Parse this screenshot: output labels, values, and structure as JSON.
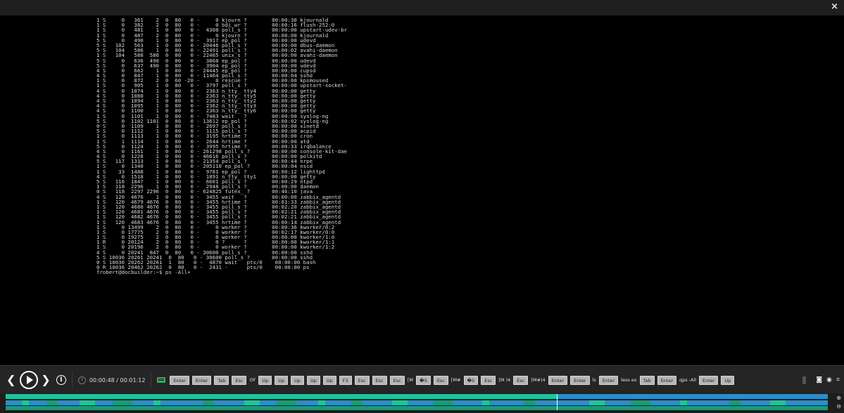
{
  "window": {
    "close_glyph": "×"
  },
  "terminal": {
    "lines": [
      "1 S     0   361    2  0  80   0 -     0 kjourn ?        00:00:30 kjournald",
      "1 S     0   382    2  0  80   0 -     0 bdi_wr ?        00:00:16 flush-252:0",
      "1 S     0   481    1  0  80   0 -  4308 poll_s ?        00:00:00 upstart-udev-br",
      "1 S     0   487    2  0  80   0 -     0 kjourn ?        00:00:00 kjournald",
      "5 S     0   490    1  0  80   0 -  3917 ep_pol ?        00:00:00 udevd",
      "5 S   102   563    1  0  80   0 - 20446 poll_s ?        00:00:00 dbus-daemon",
      "5 S   104   586    1  0  80   0 - 22491 poll_s ?        00:00:02 avahi-daemon",
      "1 S   104   588  586  0  80   0 - 22465 unix_s ?        00:00:00 avahi-daemon",
      "5 S     0   636  490  0  80   0 -  3868 ep_pol ?        00:00:00 udevd",
      "5 S     0   637  490  0  80   0 -  3904 ep_pol ?        00:00:00 udevd",
      "4 S     0   662    1  0  80   0 - 24445 ep_pol ?        00:00:00 cupsd",
      "4 S     0   847    1  0  80   0 - 11464 poll_s ?        00:00:04 sshd",
      "1 S     0   872    2  0  60 -20 -     0 rescue ?        00:00:00 kpsmoused",
      "1 S     0   905    1  0  80   0 -  3797 poll_s ?        00:00:00 upstart-socket-",
      "4 S     0  1074    1  0  80   0 -  2363 n_tty_ tty4     00:00:00 getty",
      "4 S     0  1080    1  0  80   0 -  2363 n_tty_ tty5     00:00:00 getty",
      "4 S     0  1094    1  0  80   0 -  2363 n_tty_ tty2     00:00:00 getty",
      "4 S     0  1095    1  0  80   0 -  2362 n_tty_ tty3     00:00:00 getty",
      "4 S     0  1100    1  0  80   0 -  2363 n_tty_ tty6     00:00:00 getty",
      "1 S     0  1101    1  0  80   0 -  7483 wait   ?        00:00:00 syslog-ng",
      "5 S     0  1102 1101  0  80   0 - 13612 ep_pol ?        00:00:02 syslog-ng",
      "0 S     0  1109    1  0  80   0 -  2697 poll_s ?        00:00:00 xinetd",
      "5 S     0  1112    1  0  80   0 -  1115 poll_s ?        00:00:00 acpid",
      "1 S     0  1113    1  0  80   0 -  3195 hrtime ?        00:00:00 cron",
      "1 S     1  1114    1  0  80   0 -  2644 hrtime ?        00:00:00 atd",
      "5 S     0  1124    1  0  80   0 -  3995 hrtime ?        00:00:33 irqbalance",
      "4 S     0  1161    1  0  80   0 - 261298 poll_s ?       00:00:00 console-kit-dae",
      "4 S     0  1228    1  0  80   0 - 46616 poll_s ?        00:00:00 polkitd",
      "5 S   117  1313    1  0  80   0 - 21354 poll_s ?        00:00:44 nrpe",
      "1 S     0  1340    1  0  80   0 - 205110 ep_pol ?       00:00:04 nscd",
      "1 S    33  1488    1  0  80   0 -  9781 ep_pol ?        00:00:12 lighttpd",
      "4 S     0  1518    1  0  80   0 -  1891 n_tty_ tty1     00:00:00 getty",
      "5 S   116  1847    1  0  80   0 -  6601 poll_s ?        00:00:29 ntpd",
      "1 S   118  2296    1  0  80   0 -  2948 poll_s ?        00:00:00 daemon",
      "0 S   118  2297 2296  0  80   0 - 624825 futex_ ?       00:46:10 java",
      "4 S   120  4676    1  0  80   0 -  3455 wait   ?        00:00:00 zabbix_agentd",
      "1 S   120  4679 4676  0  80   0 -  3455 hrtime ?        00:01:33 zabbix_agentd",
      "1 S   120  4680 4676  0  80   0 -  3455 poll_s ?        00:02:20 zabbix_agentd",
      "1 S   120  4681 4676  0  80   0 -  3455 poll_s ?        00:02:21 zabbix_agentd",
      "1 S   120  4682 4676  0  80   0 -  3455 poll_s ?        00:02:21 zabbix_agentd",
      "1 S   120  4683 4676  0  80   0 -  3455 hrtime ?        00:00:14 zabbix_agentd",
      "1 S     0 13499    2  0  80   0 -     0 worker ?        00:00:36 kworker/0:2",
      "1 S     0 17775    2  0  80   0 -     0 worker ?        00:02:17 kworker/0:0",
      "1 S     0 19275    2  0  80   0 -     0 worker ?        00:00:00 kworker/1:0",
      "1 R     0 20124    2  0  80   0 -     0 ?      ?        00:00:00 kworker/1:1",
      "1 S     0 20196    2  0  80   0 -     0 worker ?        00:00:00 kworker/1:2",
      "4 S     0 20241  847  0  80   0 - 30600 poll_s ?        00:00:00 sshd",
      "5 S 10036 20261 20241  0  80   0 - 30600 poll_s ?       00:00:00 sshd",
      "0 S 10036 20262 20261  1  80   0 -  4870 wait   pts/0    00:00:00 bash",
      "0 R 10036 20462 20262  0  80   0 -  2431 -      pts/0    00:00:00 ps"
    ],
    "prompt": "frobert@docbuilder:~$ ps -All+"
  },
  "controls": {
    "prev_glyph": "❮",
    "next_glyph": "❯",
    "info_glyph": "i",
    "time": "00:00:48 / 00:01:12",
    "keys": [
      {
        "type": "key",
        "text": "Enter"
      },
      {
        "type": "key",
        "text": "Enter"
      },
      {
        "type": "key",
        "text": "Tab"
      },
      {
        "type": "key",
        "text": "Esc"
      },
      {
        "type": "text",
        "text": "OF"
      },
      {
        "type": "key",
        "text": "Up"
      },
      {
        "type": "key",
        "text": "Up"
      },
      {
        "type": "key",
        "text": "Up"
      },
      {
        "type": "key",
        "text": "Up"
      },
      {
        "type": "key",
        "text": "Up"
      },
      {
        "type": "key",
        "text": "F3"
      },
      {
        "type": "key",
        "text": "Esc"
      },
      {
        "type": "key",
        "text": "Esc"
      },
      {
        "type": "key",
        "text": "Esc"
      },
      {
        "type": "text",
        "text": "[M"
      },
      {
        "type": "key",
        "text": "�S"
      },
      {
        "type": "key",
        "text": "Esc"
      },
      {
        "type": "text",
        "text": "[M#"
      },
      {
        "type": "key",
        "text": "�S"
      },
      {
        "type": "key",
        "text": "Esc"
      },
      {
        "type": "text",
        "text": "[M )4"
      },
      {
        "type": "key",
        "text": "Esc"
      },
      {
        "type": "text",
        "text": "[M#)4"
      },
      {
        "type": "key",
        "text": "Enter"
      },
      {
        "type": "key",
        "text": "Enter"
      },
      {
        "type": "text",
        "text": "ls"
      },
      {
        "type": "key",
        "text": "Enter"
      },
      {
        "type": "text",
        "text": "less ex"
      },
      {
        "type": "key",
        "text": "Tab"
      },
      {
        "type": "key",
        "text": "Enter"
      },
      {
        "type": "text",
        "text": "qps -All"
      },
      {
        "type": "key",
        "text": "Enter"
      },
      {
        "type": "key",
        "text": "Up"
      }
    ],
    "right_icons": [
      "camera-icon",
      "eye-icon",
      "fullscreen-icon"
    ]
  },
  "timeline": {
    "progress": 0.67,
    "colors": {
      "played": "#22c39c",
      "track": "#2c8ec6",
      "activity": "#1b9a7a"
    }
  }
}
